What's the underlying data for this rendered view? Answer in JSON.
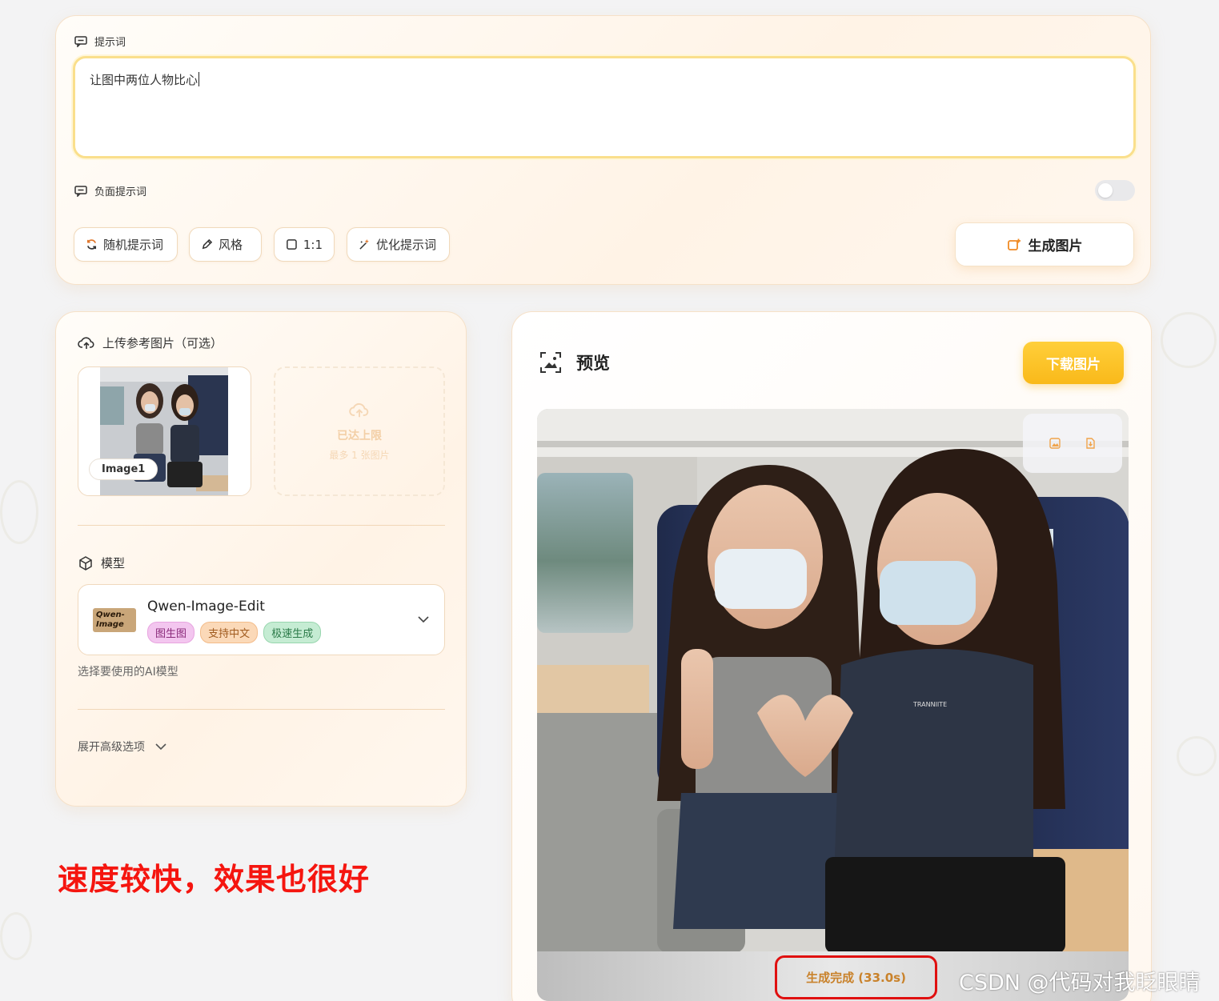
{
  "prompt_panel": {
    "prompt_label": "提示词",
    "prompt_value": "让图中两位人物比心",
    "negative_label": "负面提示词",
    "negative_enabled": false,
    "chips": {
      "random": "随机提示词",
      "style": "风格",
      "ratio": "1:1",
      "optimize": "优化提示词"
    },
    "generate_label": "生成图片"
  },
  "settings_panel": {
    "upload_label": "上传参考图片（可选）",
    "image_tag": "Image1",
    "limit_title": "已达上限",
    "limit_sub": "最多 1 张图片",
    "model_label": "模型",
    "model_name": "Qwen-Image-Edit",
    "model_logo_text": "Qwen-Image",
    "model_tags": [
      "图生图",
      "支持中文",
      "极速生成"
    ],
    "model_hint": "选择要使用的AI模型",
    "advanced_label": "展开高级选项"
  },
  "preview_panel": {
    "title": "预览",
    "download_label": "下载图片",
    "status_text": "生成完成 (33.0s)",
    "shirt_text": "TRANNIITE"
  },
  "annotation": "速度较快，效果也很好",
  "watermark": "CSDN @代码对我眨眼睛",
  "colors": {
    "accent": "#f9b91a",
    "annotation": "#f5150f",
    "status": "#c9822b"
  }
}
